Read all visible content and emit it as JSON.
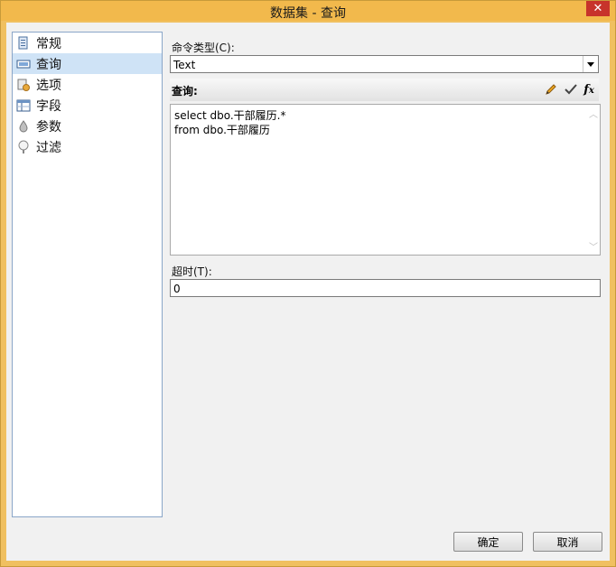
{
  "window": {
    "title": "数据集 - 查询",
    "close_label": "✕"
  },
  "nav": {
    "items": [
      {
        "label": "常规",
        "icon": "general-icon"
      },
      {
        "label": "查询",
        "icon": "query-icon",
        "selected": true
      },
      {
        "label": "选项",
        "icon": "options-icon"
      },
      {
        "label": "字段",
        "icon": "fields-icon"
      },
      {
        "label": "参数",
        "icon": "parameters-icon"
      },
      {
        "label": "过滤",
        "icon": "filter-icon"
      }
    ]
  },
  "command": {
    "label": "命令类型(C):",
    "value": "Text"
  },
  "query": {
    "label": "查询:",
    "text": "select dbo.干部履历.*\nfrom dbo.干部履历",
    "tools": [
      "pencil-icon",
      "check-icon",
      "fx-icon"
    ]
  },
  "timeout": {
    "label": "超时(T):",
    "value": "0"
  },
  "buttons": {
    "ok": "确定",
    "cancel": "取消"
  }
}
